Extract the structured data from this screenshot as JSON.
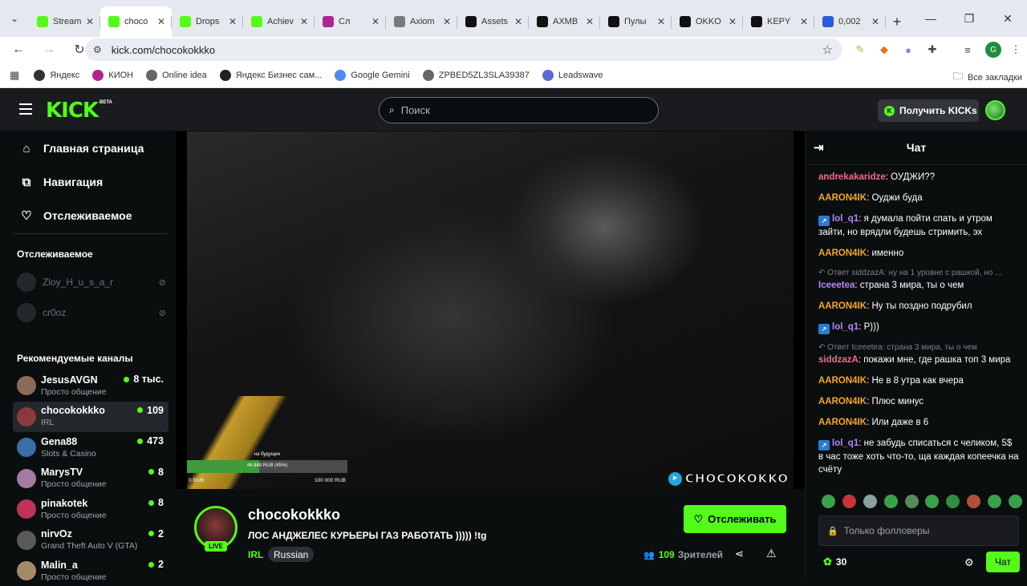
{
  "browser": {
    "tabs": [
      {
        "label": "Stream",
        "color": "#53fc18",
        "icon": "kick-icon",
        "active": false
      },
      {
        "label": "choco",
        "color": "#53fc18",
        "icon": "kick-icon",
        "active": true
      },
      {
        "label": "Drops",
        "color": "#53fc18",
        "icon": "kick-icon",
        "active": false
      },
      {
        "label": "Achiev",
        "color": "#53fc18",
        "icon": "kick-icon",
        "active": false
      },
      {
        "label": "Сл",
        "color": "#b0268f",
        "icon": "music-icon",
        "active": false
      },
      {
        "label": "Axiom",
        "color": "#7a7a7a",
        "icon": "globe-icon",
        "active": false
      },
      {
        "label": "Assets",
        "color": "#111111",
        "icon": "arrow-icon",
        "active": false
      },
      {
        "label": "AXMB",
        "color": "#111111",
        "icon": "arrow-icon",
        "active": false
      },
      {
        "label": "Пулы",
        "color": "#111111",
        "icon": "arrow-icon",
        "active": false
      },
      {
        "label": "OKKO",
        "color": "#111111",
        "icon": "arrow-icon",
        "active": false
      },
      {
        "label": "KEPY",
        "color": "#111111",
        "icon": "arrow-icon",
        "active": false
      },
      {
        "label": "0,002",
        "color": "#2d5bd8",
        "icon": "cloud-icon",
        "active": false
      }
    ],
    "url": "kick.com/chocokokkko",
    "bookmarks": [
      {
        "label": "Яндекс",
        "color": "#333333"
      },
      {
        "label": "КИОН",
        "color": "#b0268f"
      },
      {
        "label": "Online idea",
        "color": "#666666"
      },
      {
        "label": "Яндекс Бизнес сам...",
        "color": "#222222"
      },
      {
        "label": "Google Gemini",
        "color": "#4b8bf4"
      },
      {
        "label": "ZPBED5ZL3SLA39387",
        "color": "#666666"
      },
      {
        "label": "Leadswave",
        "color": "#5a6ad4"
      }
    ],
    "all_bookmarks": "Все закладки"
  },
  "header": {
    "logo": "KICK",
    "beta": "BETA",
    "search_placeholder": "Поиск",
    "get_kicks": "Получить KICKs"
  },
  "sidebar": {
    "nav": [
      {
        "label": "Главная страница",
        "icon": "home-icon"
      },
      {
        "label": "Навигация",
        "icon": "browse-icon"
      },
      {
        "label": "Отслеживаемое",
        "icon": "heart-icon"
      }
    ],
    "following_heading": "Отслеживаемое",
    "following": [
      {
        "name": "Zloy_H_u_s_a_r"
      },
      {
        "name": "cr0oz"
      }
    ],
    "recommended_heading": "Рекомендуемые каналы",
    "recommended": [
      {
        "name": "JesusAVGN",
        "category": "Просто общение",
        "viewers": "8 тыс.",
        "color": "#8a6b55"
      },
      {
        "name": "chocokokkko",
        "category": "IRL",
        "viewers": "109",
        "color": "#8a3a3a"
      },
      {
        "name": "Gena88",
        "category": "Slots & Casino",
        "viewers": "473",
        "color": "#3a6ea5"
      },
      {
        "name": "MarysTV",
        "category": "Просто общение",
        "viewers": "8",
        "color": "#a57aa0"
      },
      {
        "name": "pinakotek",
        "category": "Просто общение",
        "viewers": "8",
        "color": "#c0325a"
      },
      {
        "name": "nirvOz",
        "category": "Grand Theft Auto V (GTA)",
        "viewers": "2",
        "color": "#5a5a5a"
      },
      {
        "name": "Malin_a",
        "category": "Просто общение",
        "viewers": "2",
        "color": "#a58a6a"
      }
    ]
  },
  "player": {
    "goal_title": "на будущее",
    "goal_progress": "44 848 RUB (45%)",
    "goal_fraction": 0.45,
    "goal_min": "0 RUB",
    "goal_max": "100 000 RUB",
    "watermark": "CHOCOKOKKO"
  },
  "stream": {
    "channel": "chocokokkko",
    "live": "LIVE",
    "title": "ЛОС АНДЖЕЛЕС КУРЬЕРЫ ГАЗ РАБОТАТЬ ))))) !tg",
    "category": "IRL",
    "tag": "Russian",
    "follow": "Отслеживать",
    "viewers": "109",
    "viewers_label": "Зрителей"
  },
  "chat": {
    "title": "Чат",
    "messages": [
      {
        "user": "andrekakaridze",
        "color": "#f26b8a",
        "text": "ОУДЖИ??",
        "badge": false,
        "reply": ""
      },
      {
        "user": "AARON4IK",
        "color": "#f5a623",
        "text": "Оуджи буда",
        "badge": false,
        "reply": ""
      },
      {
        "user": "lol_q1",
        "color": "#b884f5",
        "text": "я думала пойти спать и утром зайти, но врядли будешь стримить, эх",
        "badge": true,
        "reply": ""
      },
      {
        "user": "AARON4IK",
        "color": "#f5a623",
        "text": "именно",
        "badge": false,
        "reply": ""
      },
      {
        "user": "Iceeetea",
        "color": "#b884f5",
        "text": "страна 3 мира, ты о чем",
        "badge": false,
        "reply": "Ответ siddzazA: ну на 1 уровне с рашкой, но ..."
      },
      {
        "user": "AARON4IK",
        "color": "#f5a623",
        "text": "Ну ты поздно подрубил",
        "badge": false,
        "reply": ""
      },
      {
        "user": "lol_q1",
        "color": "#b884f5",
        "text": "Р)))",
        "badge": true,
        "reply": ""
      },
      {
        "user": "siddzazA",
        "color": "#f26b8a",
        "text": "покажи мне, где рашка топ 3 мира",
        "badge": false,
        "reply": "Ответ Iceeetea: страна 3 мира, ты о чем"
      },
      {
        "user": "AARON4IK",
        "color": "#f5a623",
        "text": "Не в 8 утра как вчера",
        "badge": false,
        "reply": ""
      },
      {
        "user": "AARON4IK",
        "color": "#f5a623",
        "text": "Плюс минус",
        "badge": false,
        "reply": ""
      },
      {
        "user": "AARON4IK",
        "color": "#f5a623",
        "text": "Или даже в 6",
        "badge": false,
        "reply": ""
      },
      {
        "user": "lol_q1",
        "color": "#b884f5",
        "text": "не забудь списаться с челиком, 5$ в час тоже хоть что-то, ща каждая копеечка на счёту",
        "badge": true,
        "reply": ""
      }
    ],
    "input_placeholder": "Только фолловеры",
    "points": "30",
    "send": "Чат"
  }
}
